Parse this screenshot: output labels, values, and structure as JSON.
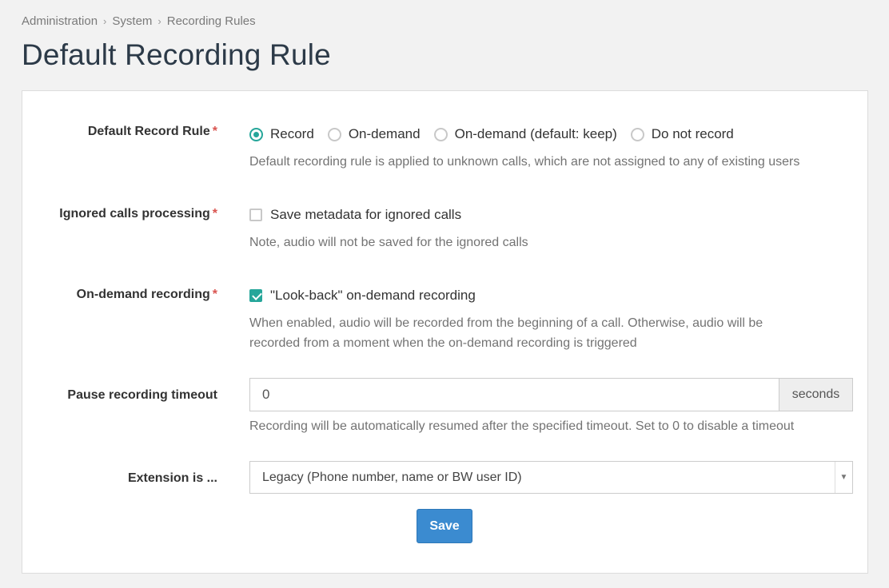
{
  "breadcrumb": [
    "Administration",
    "System",
    "Recording Rules"
  ],
  "page_title": "Default Recording Rule",
  "required_marker": "*",
  "record_rule": {
    "label": "Default Record Rule",
    "options": [
      "Record",
      "On-demand",
      "On-demand (default: keep)",
      "Do not record"
    ],
    "selected": "Record",
    "help": "Default recording rule is applied to unknown calls, which are not assigned to any of existing users"
  },
  "ignored_calls": {
    "label": "Ignored calls processing",
    "checkbox_label": "Save metadata for ignored calls",
    "checked": false,
    "help": "Note, audio will not be saved for the ignored calls"
  },
  "on_demand": {
    "label": "On-demand recording",
    "checkbox_label": "\"Look-back\" on-demand recording",
    "checked": true,
    "help_line1": "When enabled, audio will be recorded from the beginning of a call. Otherwise, audio will be",
    "help_line2": "recorded from a moment when the on-demand recording is triggered"
  },
  "pause_timeout": {
    "label": "Pause recording timeout",
    "value": "0",
    "addon": "seconds",
    "help": "Recording will be automatically resumed after the specified timeout. Set to 0 to disable a timeout"
  },
  "extension": {
    "label": "Extension is ...",
    "selected": "Legacy (Phone number, name or BW user ID)"
  },
  "save_label": "Save",
  "colors": {
    "accent": "#26a69a",
    "primary_button": "#3b8bd0",
    "required": "#d9534f"
  }
}
